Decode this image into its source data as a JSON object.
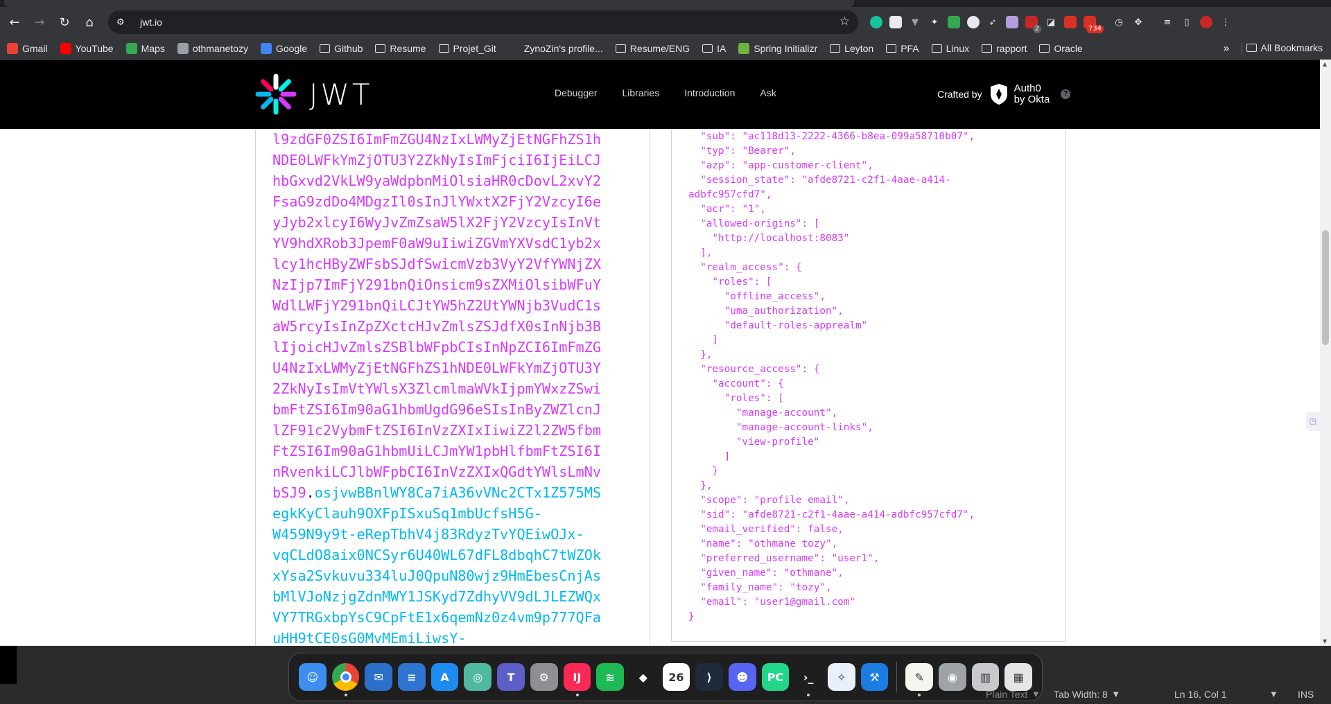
{
  "browser": {
    "url": "jwt.io",
    "extension_badges": {
      "ext_a": "2",
      "ext_b": "734"
    }
  },
  "bookmarks": {
    "items": [
      {
        "label": "Gmail",
        "icon": "gmail-icon",
        "kind": "site",
        "color": "#ea4335"
      },
      {
        "label": "YouTube",
        "icon": "youtube-icon",
        "kind": "site",
        "color": "#ff0000"
      },
      {
        "label": "Maps",
        "icon": "maps-icon",
        "kind": "site",
        "color": "#34a853"
      },
      {
        "label": "othmanetozy",
        "icon": "github-icon",
        "kind": "site",
        "color": "#9aa0a6"
      },
      {
        "label": "Google",
        "icon": "google-icon",
        "kind": "site",
        "color": "#4285f4"
      },
      {
        "label": "Github",
        "icon": "folder-icon",
        "kind": "folder"
      },
      {
        "label": "Resume",
        "icon": "folder-icon",
        "kind": "folder"
      },
      {
        "label": "Projet_Git",
        "icon": "folder-icon",
        "kind": "folder"
      },
      {
        "label": "ZynoZin's profile...",
        "icon": "profile-icon",
        "kind": "site",
        "color": "#35363a"
      },
      {
        "label": "Resume/ENG",
        "icon": "folder-icon",
        "kind": "folder"
      },
      {
        "label": "IA",
        "icon": "folder-icon",
        "kind": "folder"
      },
      {
        "label": "Spring Initializr",
        "icon": "spring-icon",
        "kind": "site",
        "color": "#6db33f"
      },
      {
        "label": "Leyton",
        "icon": "folder-icon",
        "kind": "folder"
      },
      {
        "label": "PFA",
        "icon": "folder-icon",
        "kind": "folder"
      },
      {
        "label": "Linux",
        "icon": "folder-icon",
        "kind": "folder"
      },
      {
        "label": "rapport",
        "icon": "folder-icon",
        "kind": "folder"
      },
      {
        "label": "Oracle",
        "icon": "folder-icon",
        "kind": "folder"
      }
    ],
    "more": "»",
    "all_bookmarks": "All Bookmarks"
  },
  "site": {
    "logo_text": "JWT",
    "nav": [
      "Debugger",
      "Libraries",
      "Introduction",
      "Ask"
    ],
    "crafted_by": "Crafted by",
    "auth0_line1": "Auth0",
    "auth0_line2": "by Okta",
    "help": "?"
  },
  "encoded": {
    "lines": [
      {
        "payload": "l9zdGF0ZSI6ImFmZGU4NzIxLWMyZjEtNGFhZS1h"
      },
      {
        "payload": "NDE0LWFkYmZjOTU3Y2ZkNyIsImFjciI6IjEiLCJ"
      },
      {
        "payload": "hbGxvd2VkLW9yaWdpbnMiOlsiaHR0cDovL2xvY2"
      },
      {
        "payload": "FsaG9zdDo4MDgzIl0sInJlYWxtX2FjY2VzcyI6e"
      },
      {
        "payload": "yJyb2xlcyI6WyJvZmZsaW5lX2FjY2VzcyIsInVt"
      },
      {
        "payload": "YV9hdXRob3JpemF0aW9uIiwiZGVmYXVsdC1yb2x"
      },
      {
        "payload": "lcy1hcHByZWFsbSJdfSwicmVzb3VyY2VfYWNjZX"
      },
      {
        "payload": "NzIjp7ImFjY291bnQiOnsicm9sZXMiOlsibWFuY"
      },
      {
        "payload": "WdlLWFjY291bnQiLCJtYW5hZ2UtYWNjb3VudC1s"
      },
      {
        "payload": "aW5rcyIsInZpZXctcHJvZmlsZSJdfX0sInNjb3B"
      },
      {
        "payload": "lIjoicHJvZmlsZSBlbWFpbCIsInNpZCI6ImFmZG"
      },
      {
        "payload": "U4NzIxLWMyZjEtNGFhZS1hNDE0LWFkYmZjOTU3Y"
      },
      {
        "payload": "2ZkNyIsImVtYWlsX3ZlcmlmaWVkIjpmYWxzZSwi"
      },
      {
        "payload": "bmFtZSI6Im90aG1hbmUgdG96eSIsInByZWZlcnJ"
      },
      {
        "payload": "lZF91c2VybmFtZSI6InVzZXIxIiwiZ2l2ZW5fbm"
      },
      {
        "payload": "FtZSI6Im90aG1hbmUiLCJmYW1pbHlfbmFtZSI6I"
      },
      {
        "payload": "nRvenkiLCJlbWFpbCI6InVzZXIxQGdtYWlsLmNv"
      },
      {
        "payload": "bSJ9",
        "dot": ".",
        "signature": "osjvwBBnlWY8Ca7iA36vVNc2CTx1Z575MS"
      },
      {
        "signature": "egkKyClauh9OXFpISxuSq1mbUcfsH5G-"
      },
      {
        "signature": "W459N9y9t-eRepTbhV4j83RdyzTvYQEiwOJx-"
      },
      {
        "signature": "vqCLdO8aix0NCSyr6U40WL67dFL8dbqhC7tWZOk"
      },
      {
        "signature": "xYsa2Svkuvu334luJ0QpuN80wjz9HmEbesCnjAs"
      },
      {
        "signature": "bMlVJoNzjgZdnMWY1JSKyd7ZdhyVV9dLJLEZWQx"
      },
      {
        "signature": "VY7TRGxbpYsC9CpFtE1x6qemNz0z4vm9p777QFa"
      },
      {
        "signature": "uHH9tCE0sG0MvMEmiLiwsY-"
      }
    ]
  },
  "decoded": {
    "lines": [
      "  \"sub\": \"ac118d13-2222-4366-b8ea-099a58710b07\",",
      "  \"typ\": \"Bearer\",",
      "  \"azp\": \"app-customer-client\",",
      "  \"session_state\": \"afde8721-c2f1-4aae-a414-",
      "adbfc957cfd7\",",
      "  \"acr\": \"1\",",
      "  \"allowed-origins\": [",
      "    \"http://localhost:8083\"",
      "  ],",
      "  \"realm_access\": {",
      "    \"roles\": [",
      "      \"offline_access\",",
      "      \"uma_authorization\",",
      "      \"default-roles-apprealm\"",
      "    ]",
      "  },",
      "  \"resource_access\": {",
      "    \"account\": {",
      "      \"roles\": [",
      "        \"manage-account\",",
      "        \"manage-account-links\",",
      "        \"view-profile\"",
      "      ]",
      "    }",
      "  },",
      "  \"scope\": \"profile email\",",
      "  \"sid\": \"afde8721-c2f1-4aae-a414-adbfc957cfd7\",",
      "  \"email_verified\": false,",
      "  \"name\": \"othmane tozy\",",
      "  \"preferred_username\": \"user1\",",
      "  \"given_name\": \"othmane\",",
      "  \"family_name\": \"tozy\",",
      "  \"email\": \"user1@gmail.com\"",
      "}"
    ]
  },
  "colors": {
    "payload": "#d63aff",
    "signature": "#00b9f1",
    "header_bg": "#000000"
  },
  "dock": {
    "apps": [
      {
        "name": "finder-icon",
        "color": "#3d8ef0",
        "glyph": "☺",
        "running": false
      },
      {
        "name": "chrome-icon",
        "color": "#f1f3f4",
        "glyph": "",
        "running": true,
        "chrome": true
      },
      {
        "name": "thunderbird-icon",
        "color": "#2a6fc9",
        "glyph": "✉",
        "running": false
      },
      {
        "name": "text-editor-icon",
        "color": "#2f74d0",
        "glyph": "≡",
        "running": false
      },
      {
        "name": "app-store-icon",
        "color": "#1d8cf0",
        "glyph": "A",
        "running": false
      },
      {
        "name": "globe-app-icon",
        "color": "#4fb99f",
        "glyph": "◎",
        "running": false
      },
      {
        "name": "teams-icon",
        "color": "#5b5fc7",
        "glyph": "T",
        "running": false
      },
      {
        "name": "settings-icon",
        "color": "#8e8e93",
        "glyph": "⚙",
        "running": false
      },
      {
        "name": "intellij-icon",
        "color": "#fe2857",
        "glyph": "IJ",
        "running": true
      },
      {
        "name": "spotify-icon",
        "color": "#1db954",
        "glyph": "≋",
        "running": false
      },
      {
        "name": "figma-icon",
        "color": "#1e1e1e",
        "glyph": "◆",
        "running": false
      },
      {
        "name": "calendar-icon",
        "color": "#ffffff",
        "glyph": "26",
        "running": false,
        "dark_text": true
      },
      {
        "name": "vscode-icon",
        "color": "#1f2b3a",
        "glyph": "⟩",
        "running": false
      },
      {
        "name": "discord-icon",
        "color": "#5865f2",
        "glyph": "☻",
        "running": false
      },
      {
        "name": "pycharm-icon",
        "color": "#21d789",
        "glyph": "PC",
        "running": false
      },
      {
        "name": "terminal-icon",
        "color": "#1e1e1e",
        "glyph": "›_",
        "running": true
      },
      {
        "name": "safari-icon",
        "color": "#e8f1fb",
        "glyph": "✧",
        "running": false,
        "dark_text": true
      },
      {
        "name": "xcode-icon",
        "color": "#1b7de2",
        "glyph": "⚒",
        "running": false
      }
    ],
    "trailing": [
      {
        "name": "notes-icon",
        "color": "#f5f5f0",
        "glyph": "✎",
        "running": true,
        "dark_text": true
      },
      {
        "name": "disk-utility-icon",
        "color": "#9ea3a8",
        "glyph": "◉",
        "running": false
      },
      {
        "name": "trash-icon",
        "color": "#c7c9cc",
        "glyph": "▥",
        "running": false,
        "dark_text": true
      },
      {
        "name": "launchpad-icon",
        "color": "#e5e5e5",
        "glyph": "▦",
        "running": false,
        "dark_text": true
      }
    ]
  },
  "statusbar": {
    "plain_text": "Plain Text",
    "tab_width": "Tab Width: 8",
    "position": "Ln 16, Col 1",
    "mode": "INS"
  }
}
